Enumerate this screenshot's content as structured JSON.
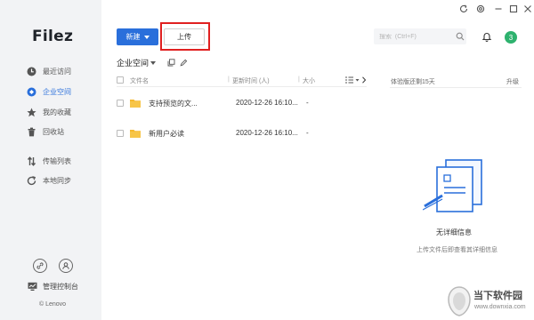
{
  "sidebar": {
    "logo": "Filez",
    "items": [
      {
        "label": "最近访问",
        "icon": "clock-icon"
      },
      {
        "label": "企业空间",
        "icon": "enterprise-space-icon",
        "active": true
      },
      {
        "label": "我的收藏",
        "icon": "star-icon"
      },
      {
        "label": "回收站",
        "icon": "trash-icon"
      },
      {
        "label": "传输列表",
        "icon": "transfer-icon"
      },
      {
        "label": "本地同步",
        "icon": "sync-icon"
      }
    ],
    "admin_label": "管理控制台",
    "copyright": "© Lenovo"
  },
  "toolbar": {
    "new_label": "新建",
    "upload_label": "上传",
    "search_placeholder": "搜索  (Ctrl+F)",
    "avatar_text": "3"
  },
  "breadcrumb": {
    "label": "企业空间"
  },
  "table": {
    "columns": {
      "name": "文件名",
      "modified": "更新时间 (人)",
      "size": "大小"
    },
    "rows": [
      {
        "name": "支持预览的文...",
        "modified": "2020-12-26 16:10...",
        "size": "-"
      },
      {
        "name": "新用户必读",
        "modified": "2020-12-26 16:10...",
        "size": "-"
      }
    ]
  },
  "detail": {
    "header": "体验版还剩15天",
    "upgrade": "升级",
    "empty_title": "无详细信息",
    "empty_desc": "上传文件后即查看其详细信息"
  },
  "watermark": {
    "text": "当下软件园",
    "url": "www.downxia.com"
  },
  "colors": {
    "accent": "#2a6fdb",
    "highlight_border": "#e02020",
    "avatar": "#2eb26e",
    "folder": "#f5b82e"
  }
}
